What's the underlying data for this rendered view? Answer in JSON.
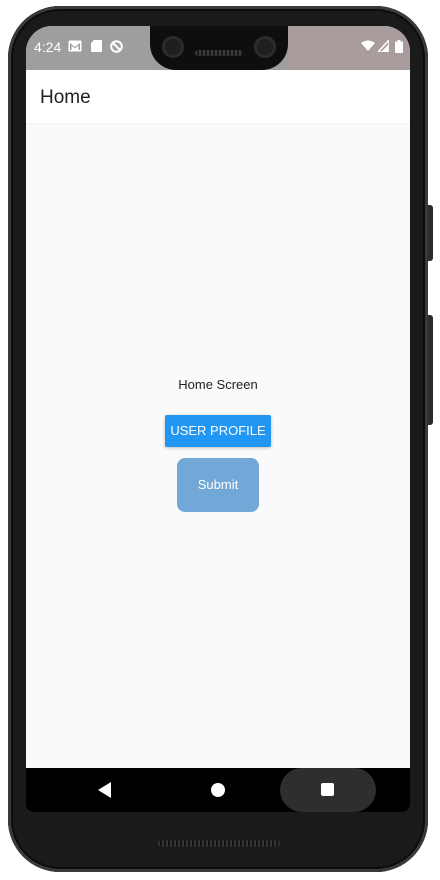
{
  "status_bar": {
    "time": "4:24",
    "left_icons": [
      "gmail-icon",
      "sd-card-icon",
      "no-disturb-icon"
    ],
    "right_icons": [
      "wifi-icon",
      "cell-signal-icon",
      "battery-icon"
    ]
  },
  "app_bar": {
    "title": "Home"
  },
  "main": {
    "screen_label": "Home Screen",
    "profile_button_label": "USER PROFILE",
    "submit_button_label": "Submit"
  },
  "colors": {
    "primary": "#2196f3",
    "submit_button": "#72a8d8",
    "background": "#fafafa",
    "nav_bar": "#000000"
  },
  "nav_bar": {
    "buttons": [
      "back-icon",
      "home-icon",
      "recents-icon"
    ]
  }
}
